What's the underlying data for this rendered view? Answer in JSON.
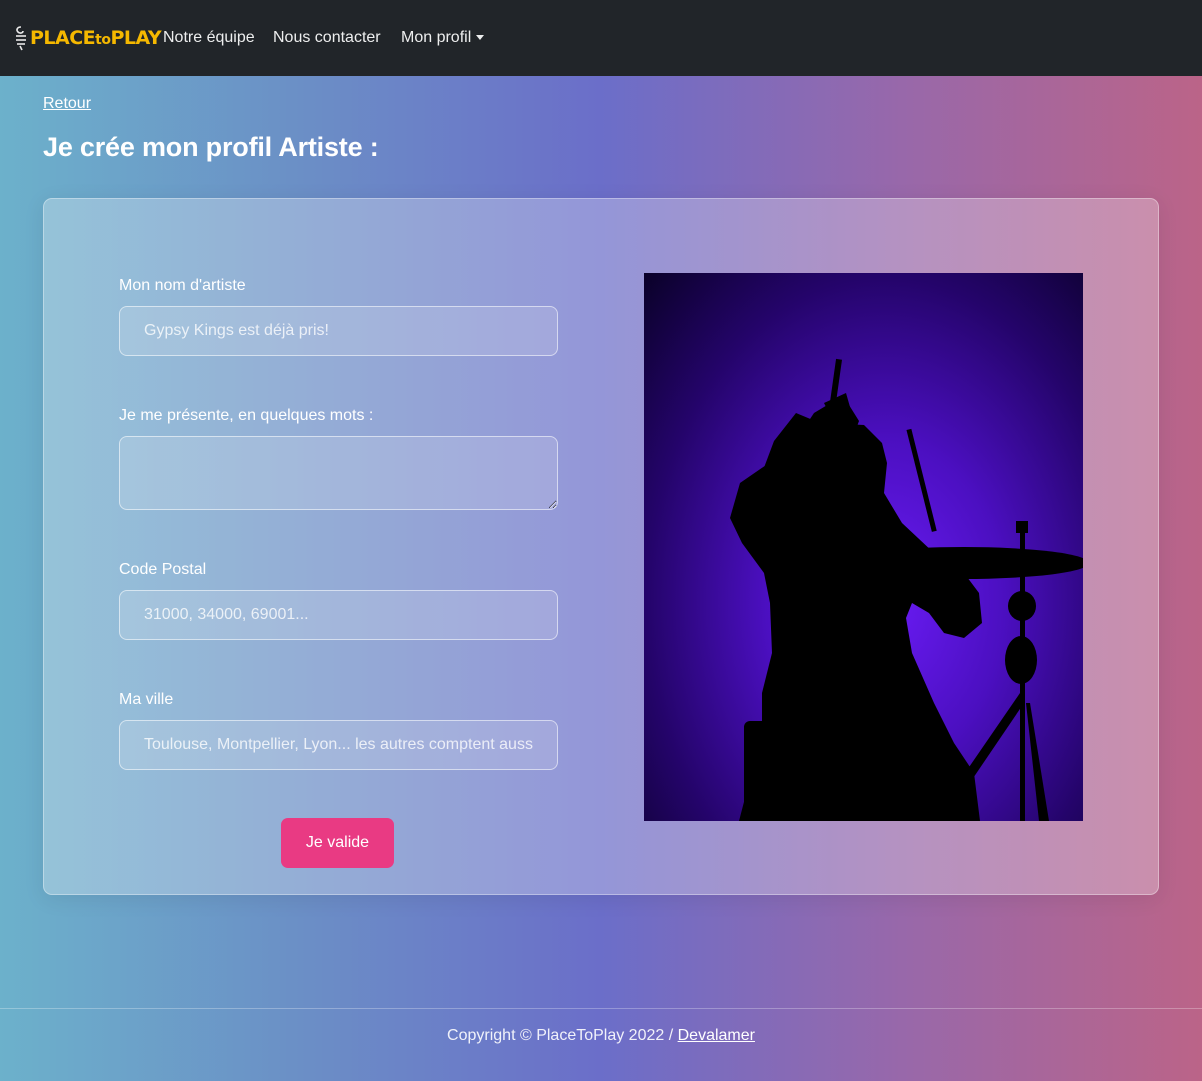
{
  "navbar": {
    "brand": {
      "prefix": "PLACE",
      "middle": "to",
      "suffix": "PLAY",
      "color": "#f5b800"
    },
    "links": {
      "team": "Notre équipe",
      "contact": "Nous contacter",
      "profile": "Mon profil"
    }
  },
  "page": {
    "back_label": "Retour",
    "title": "Je crée mon profil Artiste :"
  },
  "form": {
    "artist_name": {
      "label": "Mon nom d'artiste",
      "placeholder": "Gypsy Kings est déjà pris!",
      "value": ""
    },
    "bio": {
      "label": "Je me présente, en quelques mots :",
      "value": ""
    },
    "postal_code": {
      "label": "Code Postal",
      "placeholder": "31000, 34000, 69001...",
      "value": ""
    },
    "city": {
      "label": "Ma ville",
      "placeholder": "Toulouse, Montpellier, Lyon... les autres comptent aussi",
      "value": ""
    },
    "submit_label": "Je valide",
    "submit_color": "#e93a83"
  },
  "image": {
    "subject": "drummer-silhouette",
    "background_color": "#5a14e0"
  },
  "footer": {
    "copyright": "Copyright © PlaceToPlay 2022 / ",
    "author_link": "Devalamer"
  }
}
